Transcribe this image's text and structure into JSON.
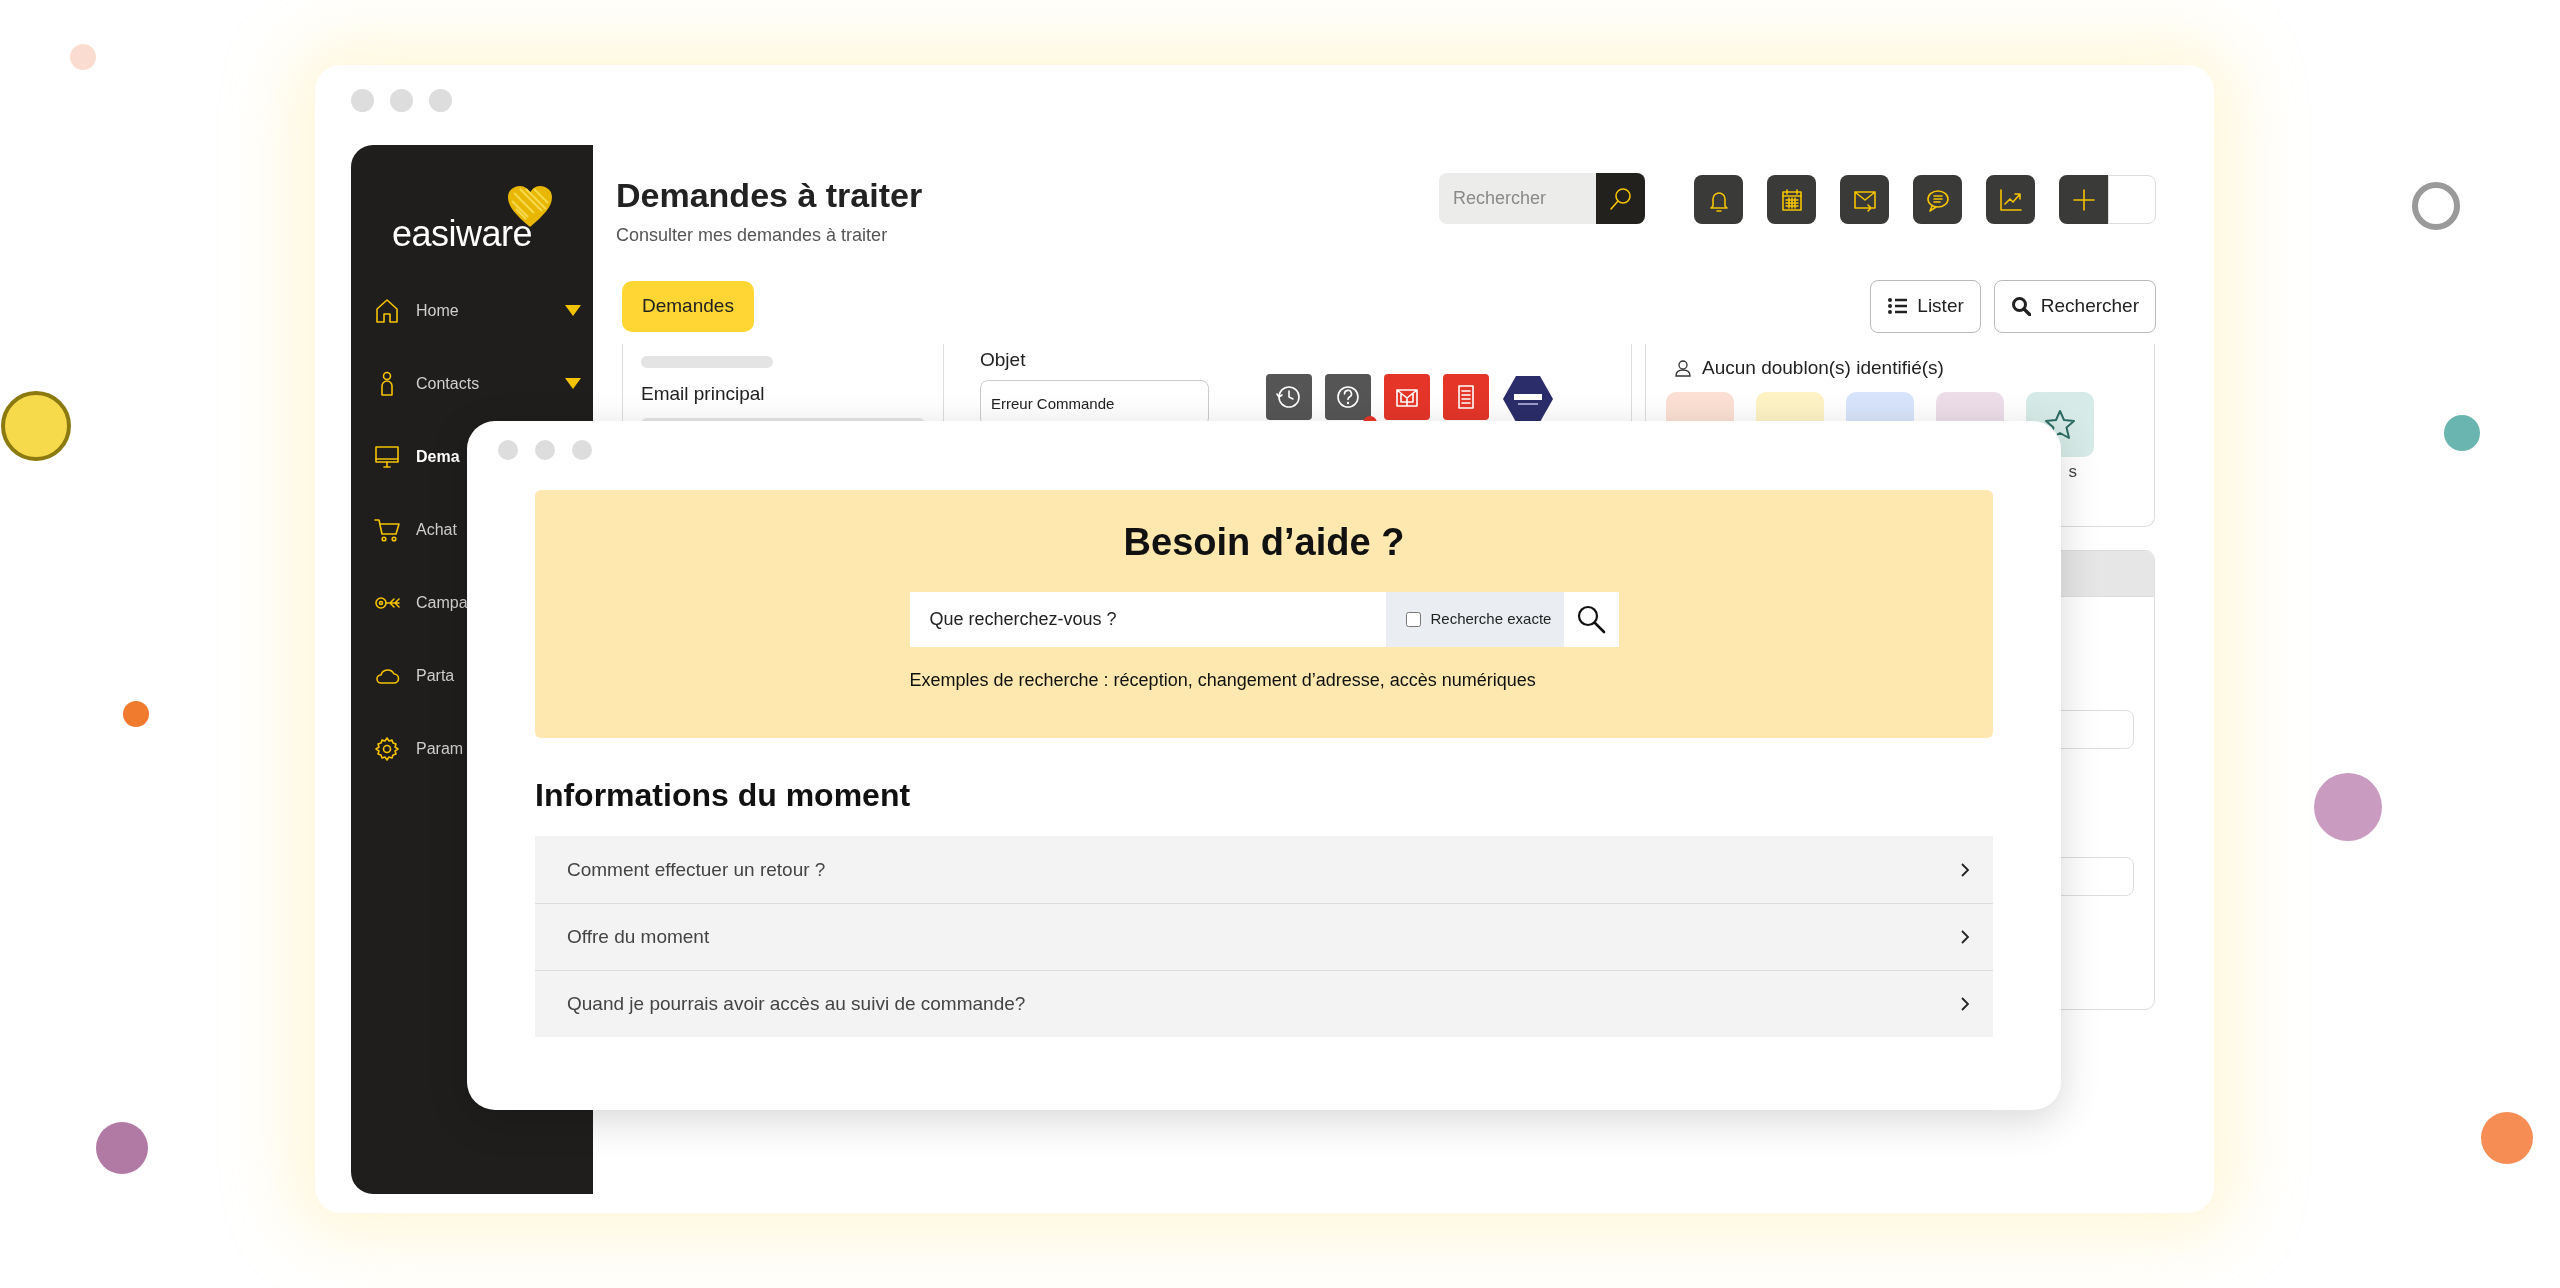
{
  "sidebar": {
    "logo": "easiware",
    "items": [
      {
        "label": "Home",
        "selected": false,
        "has_submenu": true
      },
      {
        "label": "Contacts",
        "selected": false,
        "has_submenu": true
      },
      {
        "label": "Dema",
        "selected": true,
        "has_submenu": false
      },
      {
        "label": "Achat",
        "selected": false,
        "has_submenu": false
      },
      {
        "label": "Campa",
        "selected": false,
        "has_submenu": false
      },
      {
        "label": "Parta",
        "selected": false,
        "has_submenu": false
      },
      {
        "label": "Param",
        "selected": false,
        "has_submenu": false
      }
    ]
  },
  "header": {
    "title": "Demandes à traiter",
    "subtitle": "Consulter mes demandes à traiter",
    "search": {
      "placeholder": "Rechercher"
    }
  },
  "tabs": [
    {
      "label": "Demandes",
      "selected": true
    }
  ],
  "view_buttons": [
    "Lister",
    "Rechercher"
  ],
  "form": {
    "field_label": "Email principal",
    "object_label": "Objet",
    "object_value": "Erreur Commande"
  },
  "duplicates": {
    "text": "Aucun doublon(s) identifié(s)",
    "tiles": [
      {
        "color": "#fbe0d3"
      },
      {
        "color": "#fdf3c4"
      },
      {
        "color": "#d8e4fb"
      },
      {
        "color": "#ecdde9"
      },
      {
        "color": "#d6ebe7"
      }
    ],
    "caption_fragment": "s"
  },
  "help_dialog": {
    "title": "Besoin d’aide ?",
    "search": {
      "placeholder": "Que recherchez-vous ?"
    },
    "exact_search": {
      "label": "Recherche exacte",
      "checked": false
    },
    "examples": "Exemples de recherche : réception, changement d’adresse, accès numériques",
    "section_title": "Informations du moment",
    "items": [
      {
        "label": "Comment effectuer un retour ?",
        "expanded": false
      },
      {
        "label": "Offre du moment",
        "expanded": false
      },
      {
        "label": "Quand je pourrais avoir accès au suivi de commande?",
        "expanded": false
      }
    ]
  }
}
